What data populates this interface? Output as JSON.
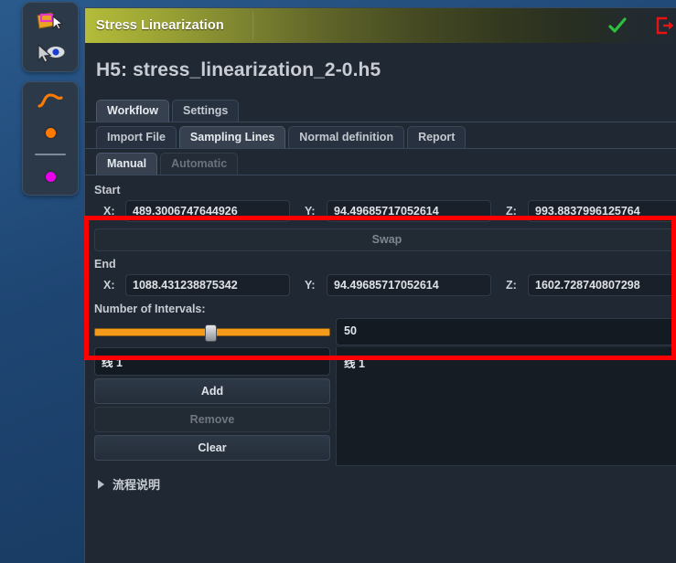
{
  "window": {
    "title": "Stress Linearization",
    "confirm_icon": "check-icon",
    "close_icon": "exit-door-icon"
  },
  "file": {
    "heading": "H5: stress_linearization_2-0.h5"
  },
  "tabs": {
    "row1": [
      {
        "label": "Workflow",
        "state": "active"
      },
      {
        "label": "Settings",
        "state": "normal"
      }
    ],
    "row2": [
      {
        "label": "Import File",
        "state": "normal"
      },
      {
        "label": "Sampling Lines",
        "state": "active"
      },
      {
        "label": "Normal definition",
        "state": "normal"
      },
      {
        "label": "Report",
        "state": "normal"
      }
    ],
    "row3": [
      {
        "label": "Manual",
        "state": "active"
      },
      {
        "label": "Automatic",
        "state": "disabled"
      }
    ]
  },
  "sampling": {
    "start_label": "Start",
    "end_label": "End",
    "axis_x": "X:",
    "axis_y": "Y:",
    "axis_z": "Z:",
    "start": {
      "x": "489.3006747644926",
      "y": "94.49685717052614",
      "z": "993.8837996125764"
    },
    "end": {
      "x": "1088.431238875342",
      "y": "94.49685717052614",
      "z": "1602.728740807298"
    },
    "swap_label": "Swap"
  },
  "intervals": {
    "label": "Number of Intervals:",
    "value": "50",
    "slider_percent": 47
  },
  "lines": {
    "name_value": "线 1",
    "add_label": "Add",
    "remove_label": "Remove",
    "clear_label": "Clear",
    "list": [
      "线 1"
    ]
  },
  "expander": {
    "label": "流程说明"
  },
  "rail": {
    "tools": [
      {
        "name": "surface-select-icon"
      },
      {
        "name": "pick-point-icon"
      },
      {
        "name": "curve-icon"
      },
      {
        "name": "orange-point-icon"
      },
      {
        "name": "magenta-point-icon"
      }
    ]
  },
  "colors": {
    "accent_orange": "#f59b1c",
    "annotation_red": "#ff0000",
    "confirm_green": "#2fbf3f",
    "title_olive": "#b4bc3a",
    "desktop_blue": "#1f4a78"
  }
}
